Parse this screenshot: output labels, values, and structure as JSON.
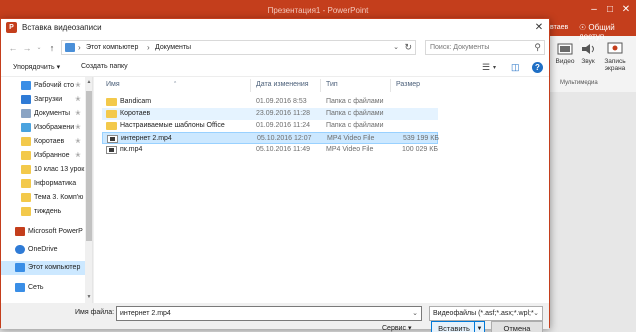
{
  "app": {
    "title": "Презентация1 - PowerPoint",
    "user": "втаев",
    "share": "Общий доступ",
    "ribbon_buttons": [
      {
        "label": "Видео",
        "icon": "video-icon"
      },
      {
        "label": "Звук",
        "icon": "speaker-icon"
      },
      {
        "label": "Запись экрана",
        "icon": "screen-record-icon"
      }
    ],
    "ribbon_group": "Мультимедиа"
  },
  "dialog": {
    "title": "Вставка видеозаписи",
    "breadcrumb": [
      "Этот компьютер",
      "Документы"
    ],
    "search_placeholder": "Поиск: Документы",
    "toolbar": {
      "organize": "Упорядочить",
      "new_folder": "Создать папку"
    },
    "sidebar": [
      {
        "label": "Рабочий сто",
        "icon": "desktop-icon",
        "pinned": true,
        "color": "#3a8ee6"
      },
      {
        "label": "Загрузки",
        "icon": "downloads-icon",
        "pinned": true,
        "color": "#2f7bd6"
      },
      {
        "label": "Документы",
        "icon": "documents-icon",
        "pinned": true,
        "color": "#8aa4c4"
      },
      {
        "label": "Изображени",
        "icon": "pictures-icon",
        "pinned": true,
        "color": "#4aa3df"
      },
      {
        "label": "Коротаев",
        "icon": "folder-icon",
        "pinned": true,
        "color": "#f3c94b"
      },
      {
        "label": "Избранное",
        "icon": "folder-icon",
        "pinned": true,
        "color": "#f3c94b"
      },
      {
        "label": "10 клас 13 урок",
        "icon": "folder-icon",
        "pinned": false,
        "color": "#f3c94b"
      },
      {
        "label": "Інформатика",
        "icon": "folder-icon",
        "pinned": false,
        "color": "#f3c94b"
      },
      {
        "label": "Тема 3. Комп'ю",
        "icon": "folder-icon",
        "pinned": false,
        "color": "#f3c94b"
      },
      {
        "label": "тиждень",
        "icon": "folder-icon",
        "pinned": false,
        "color": "#f3c94b"
      },
      {
        "label": "Microsoft PowerP",
        "icon": "powerpoint-icon",
        "pinned": false,
        "color": "#c43e1c"
      },
      {
        "label": "OneDrive",
        "icon": "onedrive-icon",
        "pinned": false,
        "color": "#2f7bd6"
      },
      {
        "label": "Этот компьютер",
        "icon": "computer-icon",
        "pinned": false,
        "color": "#3a8ee6"
      },
      {
        "label": "Сеть",
        "icon": "network-icon",
        "pinned": false,
        "color": "#3a8ee6"
      }
    ],
    "columns": [
      "Имя",
      "Дата изменения",
      "Тип",
      "Размер"
    ],
    "files": [
      {
        "name": "Bandicam",
        "date": "01.09.2016 8:53",
        "type": "Папка с файлами",
        "size": "",
        "kind": "folder",
        "state": ""
      },
      {
        "name": "Коротаев",
        "date": "23.09.2016 11:28",
        "type": "Папка с файлами",
        "size": "",
        "kind": "folder",
        "state": "hov"
      },
      {
        "name": "Настраиваемые шаблоны Office",
        "date": "01.09.2016 11:24",
        "type": "Папка с файлами",
        "size": "",
        "kind": "folder",
        "state": ""
      },
      {
        "name": "интернет 2.mp4",
        "date": "05.10.2016 12:07",
        "type": "MP4 Video File",
        "size": "539 199 КБ",
        "kind": "video",
        "state": "sel"
      },
      {
        "name": "пк.mp4",
        "date": "05.10.2016 11:49",
        "type": "MP4 Video File",
        "size": "100 029 КБ",
        "kind": "video",
        "state": ""
      }
    ],
    "filename_label": "Имя файла:",
    "filename_value": "интернет 2.mp4",
    "filetype_value": "Видеофайлы (*.asf;*.asx;*.wpl;*",
    "service_label": "Сервис",
    "insert_label": "Вставить",
    "cancel_label": "Отмена"
  }
}
